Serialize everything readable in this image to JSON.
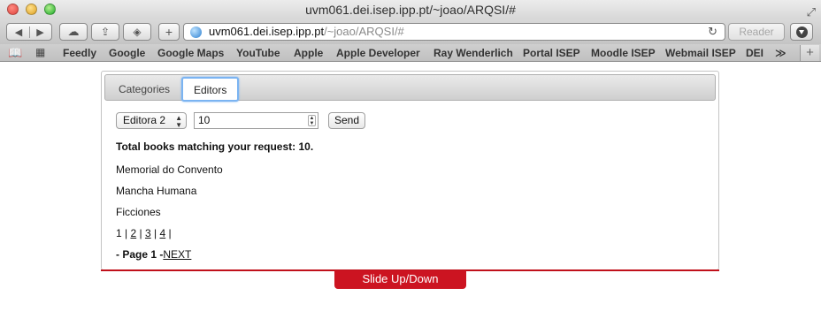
{
  "window": {
    "title": "uvm061.dei.isep.ipp.pt/~joao/ARQSI/#"
  },
  "address_bar": {
    "host": "uvm061.dei.isep.ipp.pt",
    "path": "/~joao/ARQSI/#",
    "reader_label": "Reader"
  },
  "bookmarks": [
    "Feedly",
    "Google",
    "Google Maps",
    "YouTube",
    "Apple",
    "Apple Developer",
    "Ray Wenderlich",
    "Portal ISEP",
    "Moodle ISEP",
    "Webmail ISEP",
    "DEI"
  ],
  "bookmarks_overflow": "≫",
  "tabs": {
    "categories": "Categories",
    "editors": "Editors"
  },
  "form": {
    "editor_selected": "Editora 2",
    "quantity_value": "10",
    "send_label": "Send"
  },
  "results": {
    "total": "Total books matching your request: 10.",
    "books": [
      "Memorial do Convento",
      "Mancha Humana",
      "Ficciones"
    ],
    "pages": [
      "1",
      "2",
      "3",
      "4"
    ],
    "current_page_label": "- Page 1 -",
    "next_label": "NEXT"
  },
  "slide_button": "Slide Up/Down",
  "accent_colors": {
    "slide_bar": "#cc1421",
    "active_tab_focus": "#7bb4f2"
  }
}
